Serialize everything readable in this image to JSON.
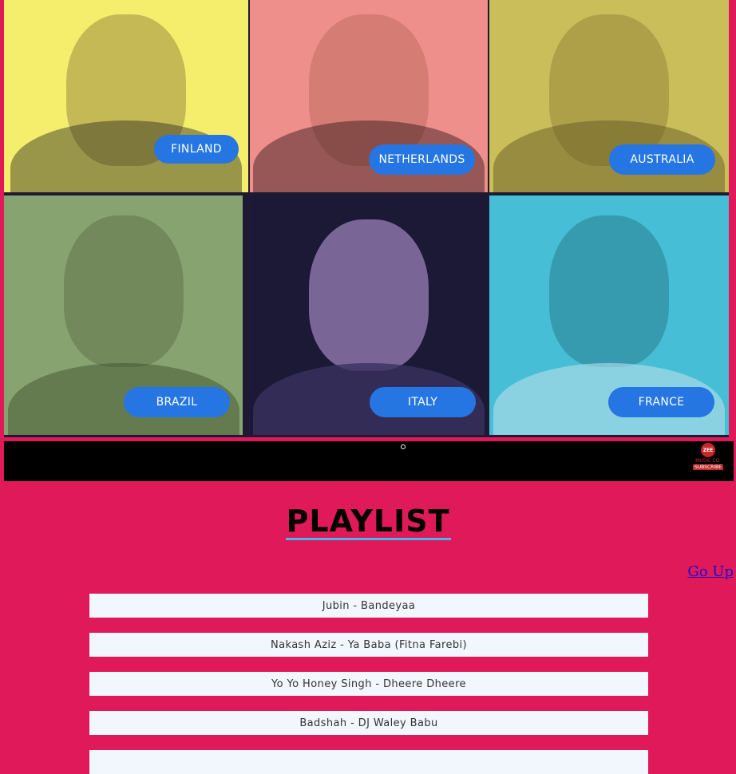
{
  "artists": [
    {
      "country": "FINLAND",
      "bg": "#f5ed6c"
    },
    {
      "country": "NETHERLANDS",
      "bg": "#ee8f8c"
    },
    {
      "country": "AUSTRALIA",
      "bg": "#c9be5a"
    },
    {
      "country": "BRAZIL",
      "bg": "#87a470"
    },
    {
      "country": "ITALY",
      "bg": "#1b1935"
    },
    {
      "country": "FRANCE",
      "bg": "#46bfd6"
    }
  ],
  "banner": {
    "logo_mark": "ZEE",
    "logo_text": "MUSIC CO.",
    "logo_cta": "SUBSCRIBE"
  },
  "playlist": {
    "title": "PLAYLIST",
    "go_up": "Go Up",
    "songs": [
      "Jubin - Bandeyaa",
      "Nakash Aziz - Ya Baba (Fitna Farebi)",
      "Yo Yo Honey Singh - Dheere Dheere",
      "Badshah - DJ Waley Babu",
      ""
    ]
  },
  "colors": {
    "page_bg": "#e0195a",
    "pill": "#2576e3",
    "song_bg": "#f1f7fd",
    "title_underline": "#49b6e8"
  }
}
